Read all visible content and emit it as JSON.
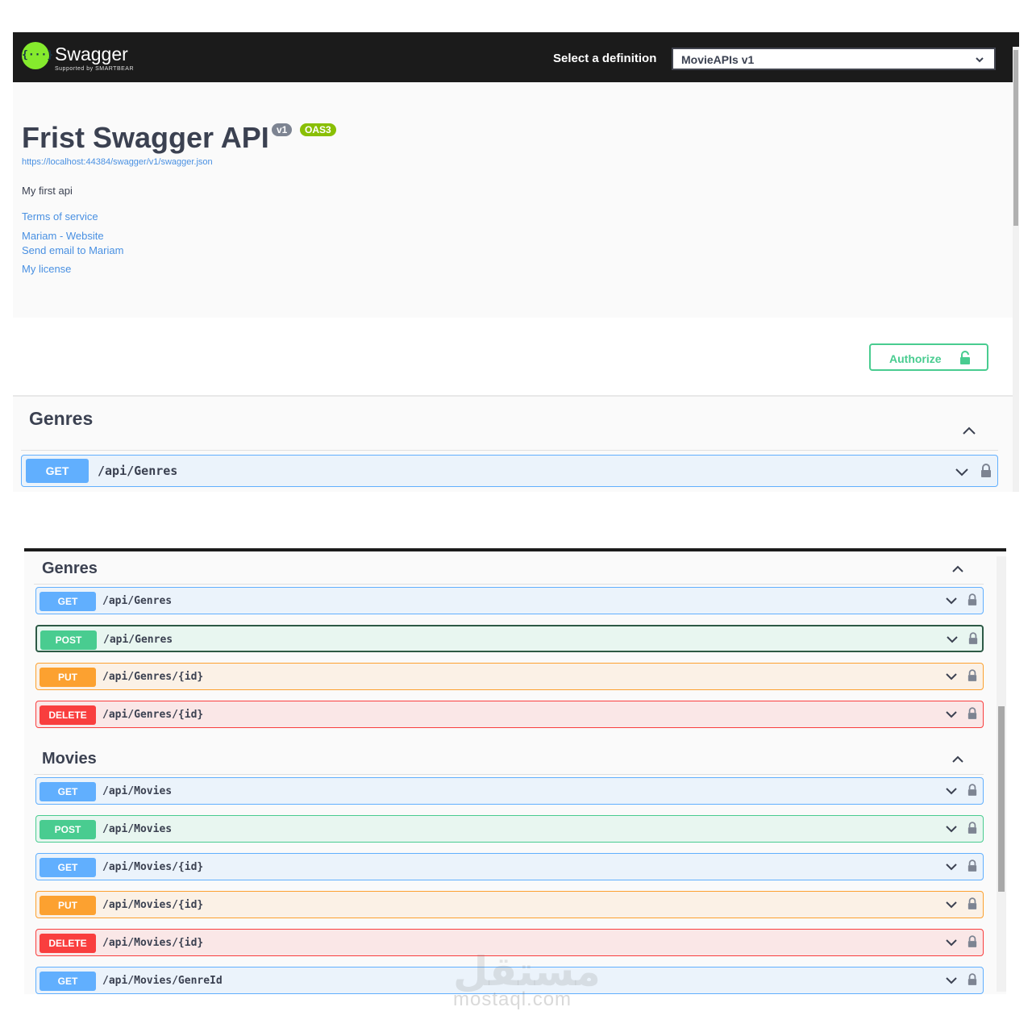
{
  "header": {
    "logo_glyph": "{···}",
    "logo_name": "Swagger",
    "logo_sub": "Supported by SMARTBEAR",
    "definition_label": "Select a definition",
    "definition_value": "MovieAPIs v1"
  },
  "info": {
    "title": "Frist Swagger API",
    "version_badge": "v1",
    "oas_badge": "OAS3",
    "spec_url": "https://localhost:44384/swagger/v1/swagger.json",
    "description": "My first api",
    "links": [
      "Terms of service",
      "Mariam - Website",
      "Send email to Mariam",
      "My license"
    ]
  },
  "authorize": {
    "label": "Authorize"
  },
  "top_section": {
    "tag": "Genres",
    "operations": [
      {
        "method": "GET",
        "path": "/api/Genres"
      }
    ]
  },
  "bottom_sections": [
    {
      "tag": "Genres",
      "operations": [
        {
          "method": "GET",
          "path": "/api/Genres"
        },
        {
          "method": "POST",
          "path": "/api/Genres"
        },
        {
          "method": "PUT",
          "path": "/api/Genres/{id}"
        },
        {
          "method": "DELETE",
          "path": "/api/Genres/{id}"
        }
      ]
    },
    {
      "tag": "Movies",
      "operations": [
        {
          "method": "GET",
          "path": "/api/Movies"
        },
        {
          "method": "POST",
          "path": "/api/Movies"
        },
        {
          "method": "GET",
          "path": "/api/Movies/{id}"
        },
        {
          "method": "PUT",
          "path": "/api/Movies/{id}"
        },
        {
          "method": "DELETE",
          "path": "/api/Movies/{id}"
        },
        {
          "method": "GET",
          "path": "/api/Movies/GenreId"
        }
      ]
    }
  ],
  "watermark": {
    "arabic": "مستقل",
    "latin": "mostaql.com"
  },
  "colors": {
    "get": "#61affe",
    "post": "#49cc90",
    "put": "#fca130",
    "delete": "#f93e3e",
    "topbar": "#1b1b1b",
    "link": "#4990e2"
  }
}
